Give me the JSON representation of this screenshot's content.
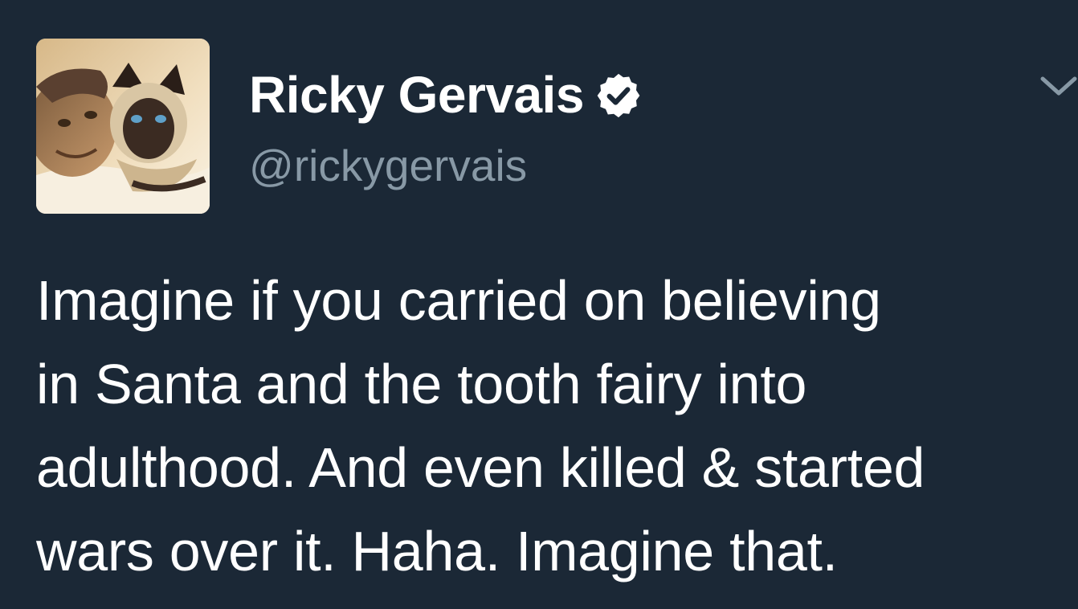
{
  "tweet": {
    "author": {
      "display_name": "Ricky Gervais",
      "handle": "@rickygervais",
      "verified": true,
      "avatar_icon": "profile-photo-with-cat",
      "verified_icon": "verified-badge-icon"
    },
    "text_lines": [
      "Imagine if you carried on believing",
      "in Santa and the tooth fairy into",
      "adulthood. And even killed & started",
      "wars over it. Haha. Imagine that."
    ],
    "menu_icon": "chevron-down-icon"
  },
  "colors": {
    "background": "#1b2836",
    "name_text": "#ffffff",
    "handle_text": "#8899a6",
    "body_text": "#ffffff",
    "caret": "#8899a6"
  }
}
